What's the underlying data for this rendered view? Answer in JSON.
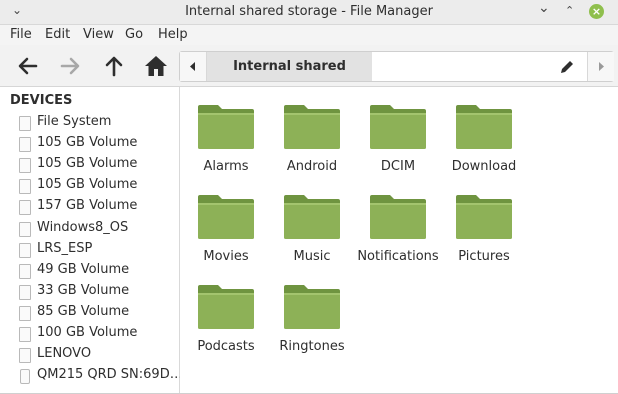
{
  "window": {
    "title": "Internal shared storage - File Manager",
    "colors": {
      "close_button": "#8fbf4d",
      "folder_fill": "#8db157",
      "folder_dark": "#6f9440"
    }
  },
  "menu": [
    "File",
    "Edit",
    "View",
    "Go",
    "Help"
  ],
  "toolbar": {
    "icons": [
      "back-arrow-icon",
      "forward-arrow-icon",
      "up-arrow-icon",
      "home-icon"
    ],
    "path": "Internal shared storage"
  },
  "sidebar": {
    "heading": "DEVICES",
    "devices": [
      "File System",
      "105 GB Volume",
      "105 GB Volume",
      "105 GB Volume",
      "157 GB Volume",
      "Windows8_OS",
      "LRS_ESP",
      "49 GB Volume",
      "33 GB Volume",
      "85 GB Volume",
      "100 GB Volume",
      "LENOVO",
      "QM215 QRD  SN:69D…"
    ]
  },
  "folders": [
    "Alarms",
    "Android",
    "DCIM",
    "Download",
    "Movies",
    "Music",
    "Notifications",
    "Pictures",
    "Podcasts",
    "Ringtones"
  ]
}
